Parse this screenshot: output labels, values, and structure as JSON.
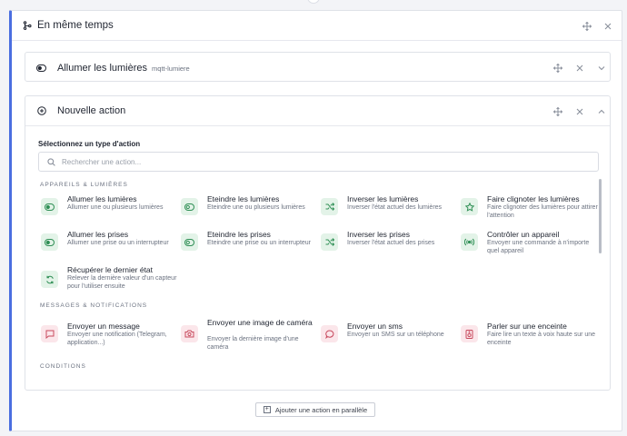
{
  "group": {
    "title": "En même temps"
  },
  "action1": {
    "title": "Allumer les lumières",
    "subtitle": "mqtt-lumiere"
  },
  "action2": {
    "title": "Nouvelle action",
    "select_label": "Sélectionnez un type d'action",
    "search_placeholder": "Rechercher une action..."
  },
  "sections": {
    "devices": "APPAREILS & LUMIÈRES",
    "messages": "MESSAGES & NOTIFICATIONS",
    "conditions": "CONDITIONS"
  },
  "devices": [
    {
      "title": "Allumer les lumières",
      "desc": "Allumer une ou plusieurs lumières",
      "icon": "toggle-on-icon"
    },
    {
      "title": "Eteindre les lumières",
      "desc": "Eteindre une ou plusieurs lumières",
      "icon": "toggle-off-icon"
    },
    {
      "title": "Inverser les lumières",
      "desc": "Inverser l'état actuel des lumières",
      "icon": "shuffle-icon"
    },
    {
      "title": "Faire clignoter les lumières",
      "desc": "Faire clignoter des lumières pour attirer l'attention",
      "icon": "star-icon"
    },
    {
      "title": "Allumer les prises",
      "desc": "Allumer une prise ou un interrupteur",
      "icon": "toggle-on-icon"
    },
    {
      "title": "Eteindre les prises",
      "desc": "Eteindre une prise ou un interrupteur",
      "icon": "toggle-off-icon"
    },
    {
      "title": "Inverser les prises",
      "desc": "Inverser l'état actuel des prises",
      "icon": "shuffle-icon"
    },
    {
      "title": "Contrôler un appareil",
      "desc": "Envoyer une commande à n'importe quel appareil",
      "icon": "broadcast-icon"
    },
    {
      "title": "Récupérer le dernier état",
      "desc": "Relever la dernière valeur d'un capteur pour l'utiliser ensuite",
      "icon": "refresh-icon"
    }
  ],
  "messages": [
    {
      "title": "Envoyer un message",
      "desc": "Envoyer une notification (Telegram, application...)",
      "icon": "message-icon"
    },
    {
      "title": "Envoyer une image de caméra",
      "desc": "Envoyer la dernière image d'une caméra",
      "icon": "camera-icon"
    },
    {
      "title": "Envoyer un sms",
      "desc": "Envoyer un SMS sur un téléphone",
      "icon": "chat-bubble-icon"
    },
    {
      "title": "Parler sur une enceinte",
      "desc": "Faire lire un texte à voix haute sur une enceinte",
      "icon": "speaker-icon"
    }
  ],
  "add_button": {
    "label": "Ajouter une action en parallèle"
  },
  "colors": {
    "accent": "#4a6ee0",
    "green_badge": "#e3f3e8",
    "green_icon": "#2f8f55",
    "pink_badge": "#fbe6ea",
    "pink_icon": "#c84a5e"
  }
}
